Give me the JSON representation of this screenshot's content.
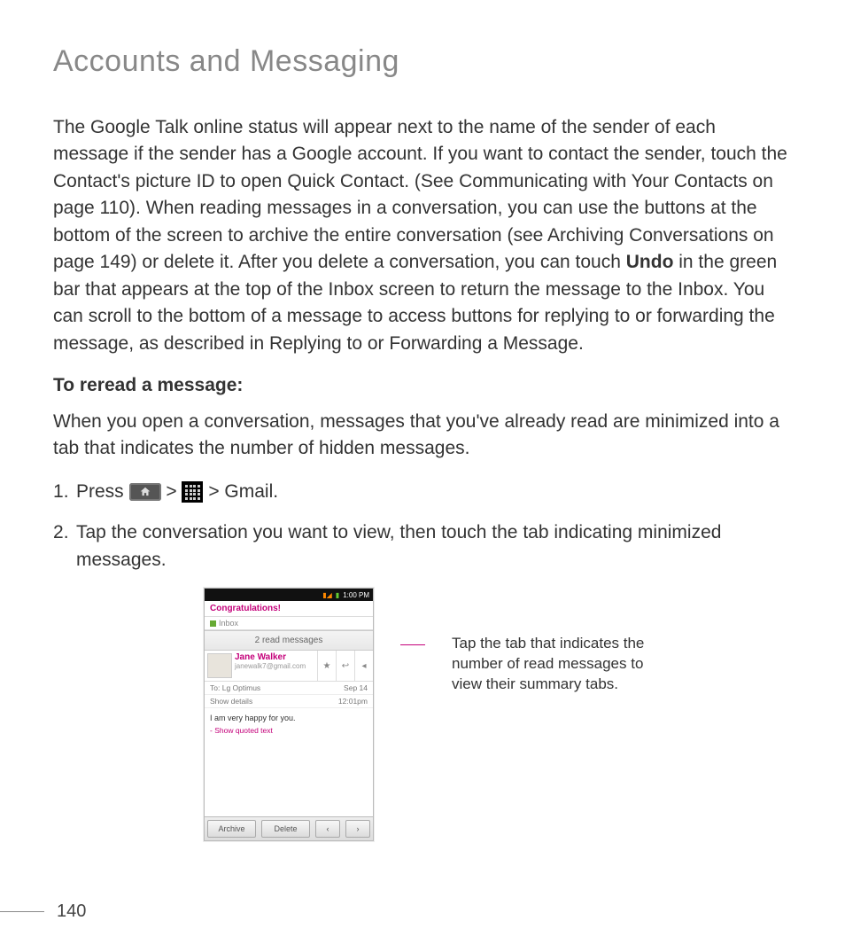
{
  "title": "Accounts and Messaging",
  "para1_a": "The Google Talk online status will appear next to the name of the sender of each message if the sender has a Google account. If you want to contact the sender, touch the Contact's picture ID to open Quick Contact. (See Communicating with Your Contacts on page 110). When reading messages in a conversation, you can use the buttons at the bottom of the screen to archive the entire conversation (see Archiving Conversations on page 149) or delete it. After you delete a conversation, you can touch ",
  "para1_bold": "Undo",
  "para1_b": " in the green bar that appears at the top of the Inbox screen to return the message to the Inbox. You can scroll to the bottom of a message to access buttons for replying to or forwarding the message, as described in Replying to or Forwarding a Message.",
  "subhead": "To reread a message:",
  "para2": "When you open a conversation, messages that you've already read are minimized into a tab that indicates the number of hidden messages.",
  "step1_a": "Press ",
  "step1_sep": " > ",
  "step1_b": " > ",
  "step1_bold": "Gmail",
  "step1_end": ".",
  "step2": "Tap the conversation you want to view, then touch the tab indicating minimized messages.",
  "callout": "Tap the tab that indicates the number of read messages to view their summary tabs.",
  "page_number": "140",
  "phone": {
    "time": "1:00 PM",
    "subject": "Congratulations!",
    "label": "Inbox",
    "read_bar": "2 read messages",
    "sender_name": "Jane Walker",
    "sender_email": "janewalk7@gmail.com",
    "to_label": "To:",
    "to_value": "Lg Optimus",
    "details": "Show details",
    "date": "Sep 14",
    "time2": "12:01pm",
    "body": "I am very happy for you.",
    "quoted": "- Show quoted text",
    "archive": "Archive",
    "delete": "Delete"
  }
}
